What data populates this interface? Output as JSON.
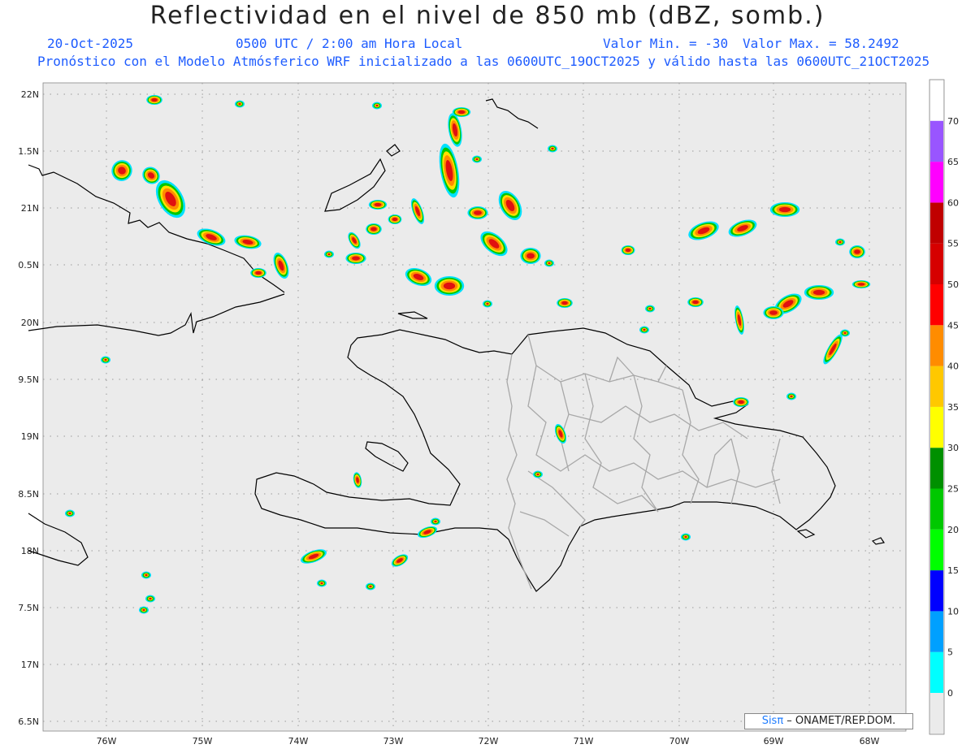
{
  "title": "Reflectividad en el nivel de 850 mb (dBZ, somb.)",
  "date": "20-Oct-2025",
  "time": "0500 UTC / 2:00 am Hora Local",
  "valmin": "Valor Min. = -30",
  "valmax": "Valor Max. = 58.2492",
  "model_line": "Pronóstico con el Modelo Atmósferico WRF inicializado a las 0600UTC_19OCT2025 y válido hasta las  0600UTC_21OCT2025",
  "credit": {
    "brand": "Sisπ",
    "text": " – ONAMET/REP.DOM."
  },
  "lat_labels": [
    "22N",
    "1.5N",
    "21N",
    "0.5N",
    "20N",
    "9.5N",
    "19N",
    "8.5N",
    "18N",
    "7.5N",
    "17N",
    "6.5N"
  ],
  "lon_labels": [
    "76W",
    "75W",
    "74W",
    "73W",
    "72W",
    "71W",
    "70W",
    "69W",
    "68W"
  ],
  "colorbar": {
    "labels": [
      "0",
      "5",
      "10",
      "15",
      "20",
      "25",
      "30",
      "35",
      "40",
      "45",
      "50",
      "55",
      "60",
      "65",
      "70"
    ],
    "colors": [
      "#00ffff",
      "#00a0ff",
      "#0000ff",
      "#00ff00",
      "#00c800",
      "#009000",
      "#ffff00",
      "#ffc800",
      "#ff8c00",
      "#ff0000",
      "#d60000",
      "#c00000",
      "#ff00ff",
      "#9955ff"
    ]
  },
  "colors": {
    "ocean": "#ebebeb",
    "coast": "#000000",
    "province": "#a0a0a0",
    "accent": "#1e5cff"
  }
}
